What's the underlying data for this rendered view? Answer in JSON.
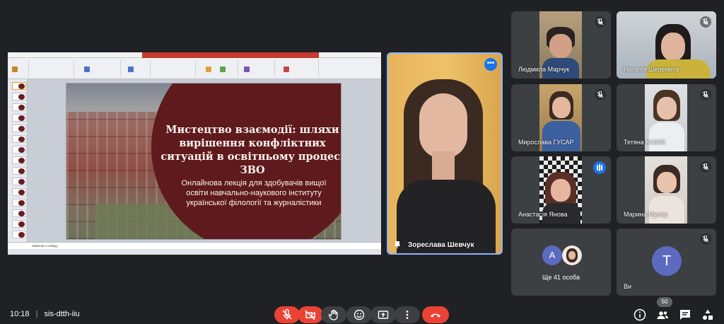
{
  "shared_screen": {
    "slide_title": "Мистецтво взаємодії: шляхи вирішення конфліктних ситуацій в освітньому процесі ЗВО",
    "slide_subtitle": "Онлайнова лекція для здобувачів вищої освіти навчально-наукового інституту української філології та журналістики",
    "notes_placeholder": "Заметки к слайду"
  },
  "speaker": {
    "name": "Зореслава Шевчук",
    "more_icon": "more-dots-icon"
  },
  "participants": [
    {
      "name": "Людмила Марчук",
      "mic": "muted"
    },
    {
      "name": "Наталія Шеремета",
      "mic": "muted"
    },
    {
      "name": "Мирослава ГУСАР",
      "mic": "muted"
    },
    {
      "name": "Тетяна КАЗИК",
      "mic": "muted"
    },
    {
      "name": "Анастасія Янова",
      "mic": "speaking"
    },
    {
      "name": "Марина Муляр",
      "mic": "muted"
    }
  ],
  "others_tile": {
    "label": "Ще 41 особа",
    "avatar_letter": "А"
  },
  "self_tile": {
    "name": "Ви",
    "avatar_letter": "Т"
  },
  "meeting": {
    "time": "10:18",
    "separator": "|",
    "code": "sis-dtth-iiu"
  },
  "people_count": "50",
  "colors": {
    "accent": "#8ab4f8",
    "danger": "#ea4335",
    "tile_bg": "#3c4043",
    "page_bg": "#202124",
    "slide_circle": "#5e1a1c"
  }
}
